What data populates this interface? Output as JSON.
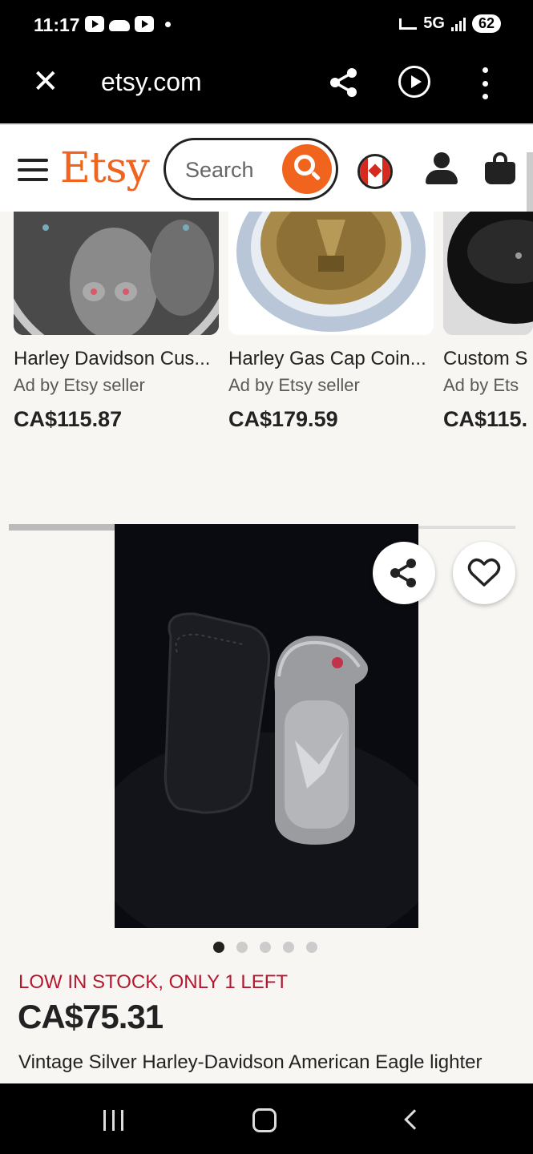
{
  "status_bar": {
    "time": "11:17",
    "network": "5G",
    "battery": "62"
  },
  "browser": {
    "url": "etsy.com"
  },
  "header": {
    "logo": "Etsy",
    "search_placeholder": "Search"
  },
  "carousel": {
    "items": [
      {
        "title": "Harley Davidson Cus...",
        "ad_label": "Ad by Etsy seller",
        "price": "CA$115.87"
      },
      {
        "title": "Harley Gas Cap Coin...",
        "ad_label": "Ad by Etsy seller",
        "price": "CA$179.59"
      },
      {
        "title": "Custom S",
        "ad_label": "Ad by Ets",
        "price": "CA$115."
      }
    ],
    "progress": 0.4
  },
  "product": {
    "image_count": 5,
    "active_image": 1,
    "stock_notice": "LOW IN STOCK, ONLY 1 LEFT",
    "price": "CA$75.31",
    "title": "Vintage Silver Harley-Davidson American Eagle lighter"
  },
  "colors": {
    "brand": "#f1641e",
    "stock_alert": "#b5172f"
  }
}
